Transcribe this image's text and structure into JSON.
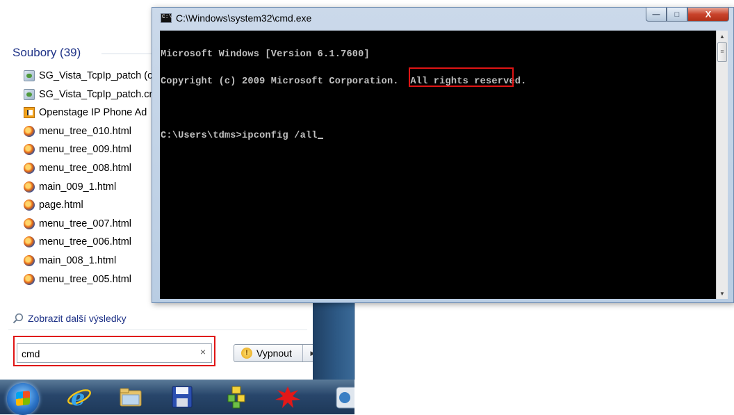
{
  "start_menu": {
    "section_title": "Soubory (39)",
    "results": [
      {
        "label": "SG_Vista_TcpIp_patch (c",
        "icon": "patch-icon"
      },
      {
        "label": "SG_Vista_TcpIp_patch.cr",
        "icon": "patch-icon"
      },
      {
        "label": "Openstage IP Phone Ad",
        "icon": "document-icon"
      },
      {
        "label": "menu_tree_010.html",
        "icon": "firefox-icon"
      },
      {
        "label": "menu_tree_009.html",
        "icon": "firefox-icon"
      },
      {
        "label": "menu_tree_008.html",
        "icon": "firefox-icon"
      },
      {
        "label": "main_009_1.html",
        "icon": "firefox-icon"
      },
      {
        "label": "page.html",
        "icon": "firefox-icon"
      },
      {
        "label": "menu_tree_007.html",
        "icon": "firefox-icon"
      },
      {
        "label": "menu_tree_006.html",
        "icon": "firefox-icon"
      },
      {
        "label": "main_008_1.html",
        "icon": "firefox-icon"
      },
      {
        "label": "menu_tree_005.html",
        "icon": "firefox-icon"
      }
    ],
    "more_results": "Zobrazit další výsledky",
    "search_value": "cmd",
    "clear_glyph": "×",
    "shutdown_label": "Vypnout",
    "shutdown_arrow": "▶"
  },
  "cmd": {
    "title": "C:\\Windows\\system32\\cmd.exe",
    "lines": [
      "Microsoft Windows [Version 6.1.7600]",
      "Copyright (c) 2009 Microsoft Corporation.  All rights reserved.",
      "",
      "C:\\Users\\tdms>ipconfig /all"
    ],
    "min_glyph": "—",
    "max_glyph": "□",
    "close_glyph": "X",
    "scroll_up": "▲",
    "scroll_down": "▼",
    "thumb_grip": "≡"
  },
  "colors": {
    "console_bg": "#000000",
    "console_fg": "#c0c0c0",
    "highlight": "#e01414",
    "link": "#1e3287"
  }
}
